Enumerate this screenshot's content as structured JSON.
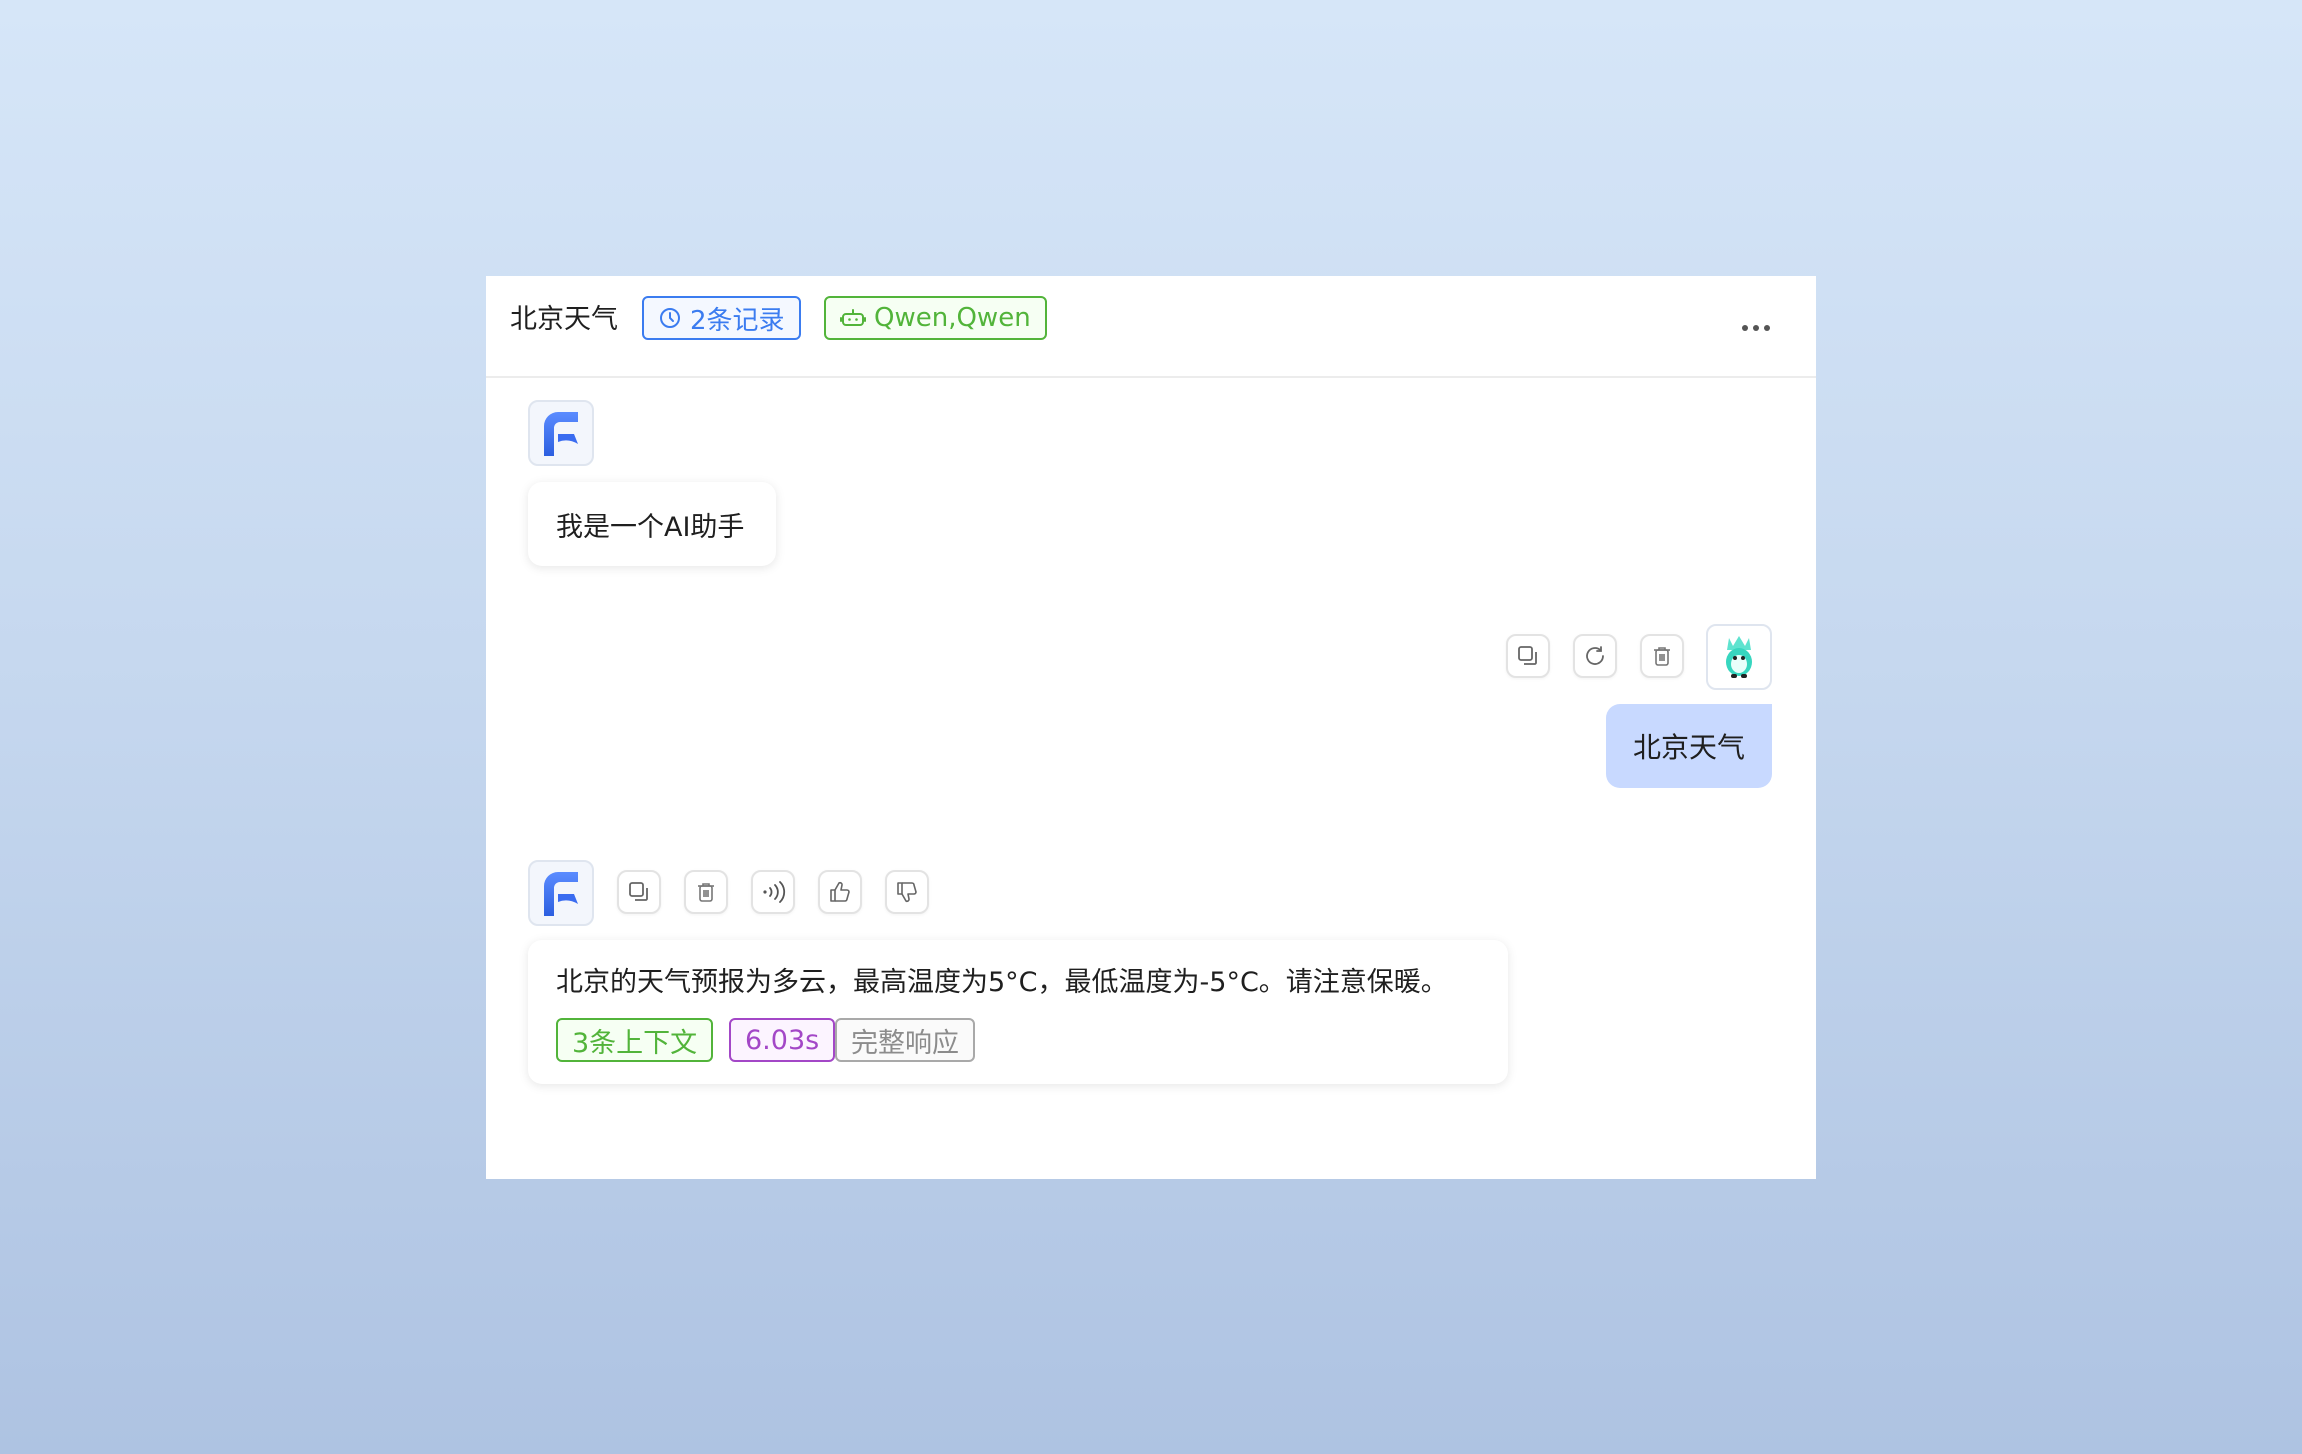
{
  "header": {
    "title": "北京天气",
    "records_tag": "2条记录",
    "models_tag": "Qwen,Qwen"
  },
  "messages": [
    {
      "role": "assistant",
      "text": "我是一个AI助手"
    },
    {
      "role": "user",
      "text": "北京天气"
    },
    {
      "role": "assistant",
      "text": "北京的天气预报为多云，最高温度为5°C，最低温度为-5°C。请注意保暖。",
      "meta": {
        "context": "3条上下文",
        "duration": "6.03s",
        "full_response": "完整响应"
      }
    }
  ],
  "colors": {
    "accent_blue": "#3b7cf0",
    "tag_green": "#52b43a",
    "tag_purple": "#a347c7",
    "user_bubble": "#c8d9ff"
  }
}
